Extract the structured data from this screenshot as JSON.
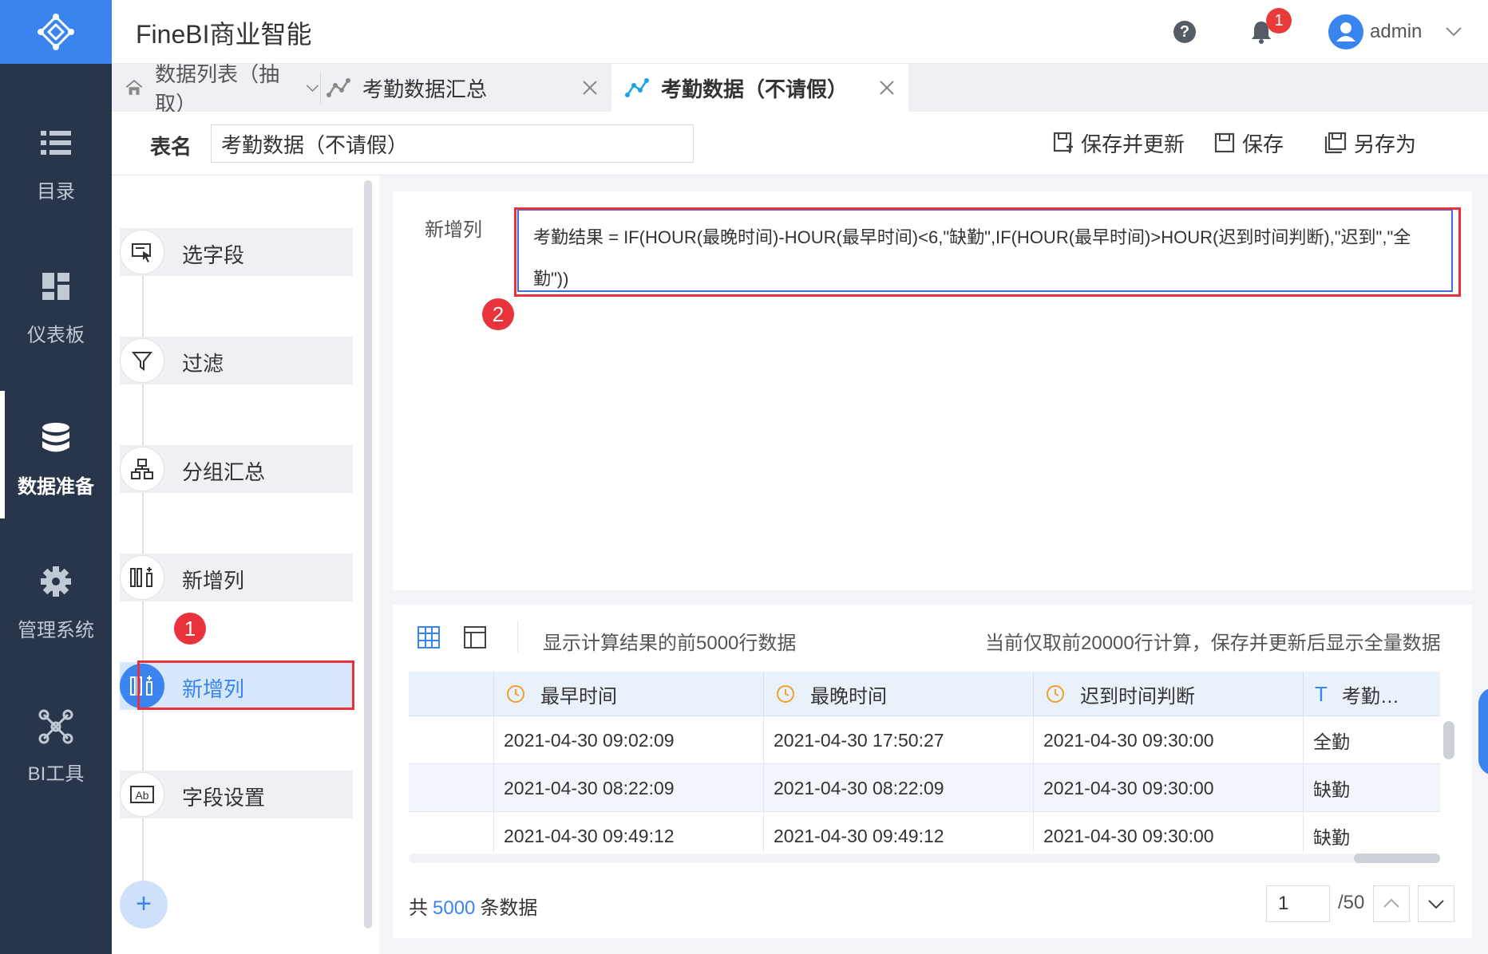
{
  "app": {
    "title": "FineBI商业智能"
  },
  "nav": {
    "items": [
      {
        "label": "目录"
      },
      {
        "label": "仪表板"
      },
      {
        "label": "数据准备"
      },
      {
        "label": "管理系统"
      },
      {
        "label": "BI工具"
      }
    ]
  },
  "header": {
    "help": "?",
    "notification_count": "1",
    "user": "admin"
  },
  "tabs": [
    {
      "label": "数据列表（抽取）"
    },
    {
      "label": "考勤数据汇总"
    },
    {
      "label": "考勤数据（不请假）"
    }
  ],
  "toolbar": {
    "table_name_label": "表名",
    "table_name_value": "考勤数据（不请假）",
    "save_update": "保存并更新",
    "save": "保存",
    "save_as": "另存为"
  },
  "steps": [
    {
      "label": "选字段"
    },
    {
      "label": "过滤"
    },
    {
      "label": "分组汇总"
    },
    {
      "label": "新增列"
    },
    {
      "label": "新增列"
    },
    {
      "label": "字段设置"
    }
  ],
  "annotations": {
    "badge1": "1",
    "badge2": "2"
  },
  "formula": {
    "label": "新增列",
    "text": "考勤结果 = IF(HOUR(最晚时间)-HOUR(最早时间)<6,\"缺勤\",IF(HOUR(最早时间)>HOUR(迟到时间判断),\"迟到\",\"全勤\"))"
  },
  "preview": {
    "info": "显示计算结果的前5000行数据",
    "note": "当前仅取前20000行计算，保存并更新后显示全量数据",
    "columns": [
      {
        "label": "最早时间",
        "type": "time"
      },
      {
        "label": "最晚时间",
        "type": "time"
      },
      {
        "label": "迟到时间判断",
        "type": "time"
      },
      {
        "label": "考勤…",
        "type": "text",
        "icon": "T"
      }
    ],
    "rows": [
      {
        "c1": "2021-04-30 09:02:09",
        "c2": "2021-04-30 17:50:27",
        "c3": "2021-04-30 09:30:00",
        "c4": "全勤"
      },
      {
        "c1": "2021-04-30 08:22:09",
        "c2": "2021-04-30 08:22:09",
        "c3": "2021-04-30 09:30:00",
        "c4": "缺勤"
      },
      {
        "c1": "2021-04-30 09:49:12",
        "c2": "2021-04-30 09:49:12",
        "c3": "2021-04-30 09:30:00",
        "c4": "缺勤"
      }
    ],
    "total_prefix": "共",
    "total_count": "5000",
    "total_suffix": "条数据",
    "page": "1",
    "page_total": "/50"
  },
  "colors": {
    "accent": "#3a84f0",
    "nav_bg": "#28354a",
    "highlight": "#e8323c"
  }
}
